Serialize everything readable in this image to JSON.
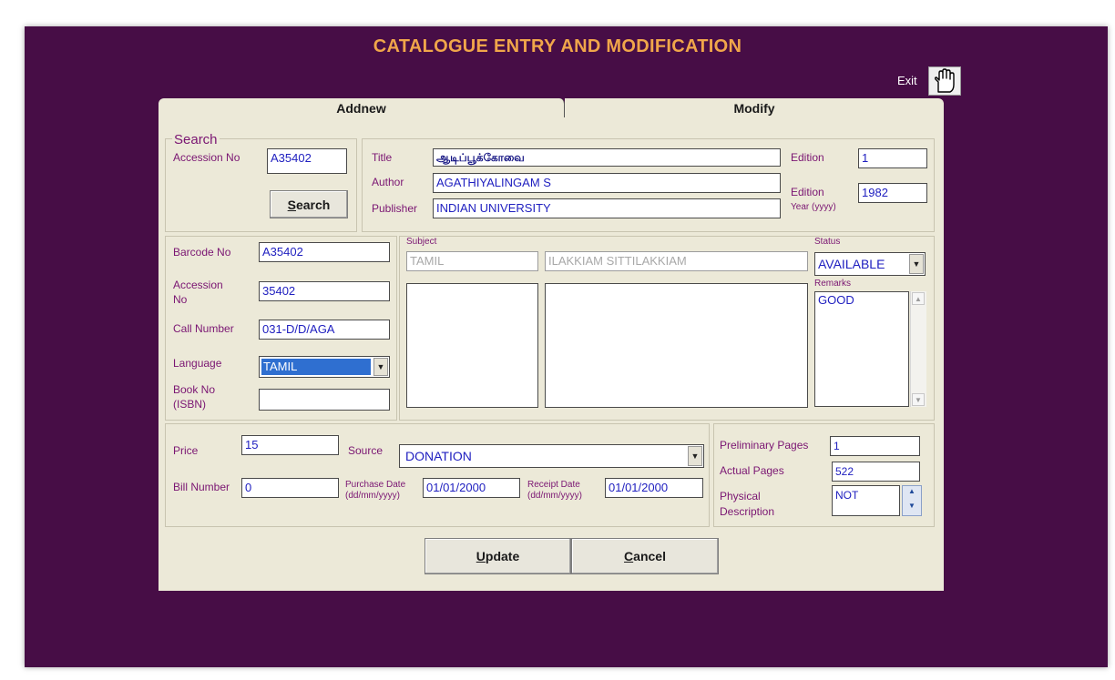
{
  "app": {
    "title": "CATALOGUE ENTRY AND MODIFICATION",
    "exit_label": "Exit"
  },
  "tabs": [
    {
      "label": "Addnew"
    },
    {
      "label": "Modify"
    }
  ],
  "search": {
    "group_label": "Search",
    "accession_label": "Accession No",
    "accession_value": "A35402",
    "button": {
      "accel": "S",
      "rest": "earch"
    }
  },
  "book": {
    "title_label": "Title",
    "title_value": "ஆடிப்பூக்கோவை",
    "author_label": "Author",
    "author_value": "AGATHIYALINGAM S",
    "publisher_label": "Publisher",
    "publisher_value": "INDIAN UNIVERSITY",
    "edition_label": "Edition",
    "edition_value": "1",
    "edition_year_label_1": "Edition",
    "edition_year_label_2": "Year (yyyy)",
    "edition_year_value": "1982"
  },
  "details": {
    "barcode_label": "Barcode No",
    "barcode_value": "A35402",
    "accession_label_1": "Accession",
    "accession_label_2": "No",
    "accession_value": "35402",
    "call_number_label": "Call Number",
    "call_number_value": "031-D/D/AGA",
    "language_label": "Language",
    "language_value": "TAMIL",
    "book_no_label_1": "Book No",
    "book_no_label_2": "(ISBN)",
    "book_no_value": ""
  },
  "subject": {
    "label": "Subject",
    "value_1": "TAMIL",
    "value_2": "ILAKKIAM SITTILAKKIAM"
  },
  "status": {
    "label": "Status",
    "value": "AVAILABLE",
    "remarks_label": "Remarks",
    "remarks_value": "GOOD"
  },
  "purchase": {
    "price_label": "Price",
    "price_value": "15",
    "source_label": "Source",
    "source_value": "DONATION",
    "bill_label": "Bill Number",
    "bill_value": "0",
    "purchase_date_label_1": "Purchase Date",
    "purchase_date_label_2": "(dd/mm/yyyy)",
    "purchase_date_value": "01/01/2000",
    "receipt_date_label_1": "Receipt Date",
    "receipt_date_label_2": "(dd/mm/yyyy)",
    "receipt_date_value": "01/01/2000"
  },
  "pages": {
    "preliminary_label": "Preliminary Pages",
    "preliminary_value": "1",
    "actual_label": "Actual Pages",
    "actual_value": "522",
    "physical_label_1": "Physical",
    "physical_label_2": "Description",
    "physical_value": "NOT"
  },
  "actions": {
    "update": {
      "accel": "U",
      "rest": "pdate"
    },
    "cancel": {
      "accel": "C",
      "rest": "ancel"
    }
  }
}
